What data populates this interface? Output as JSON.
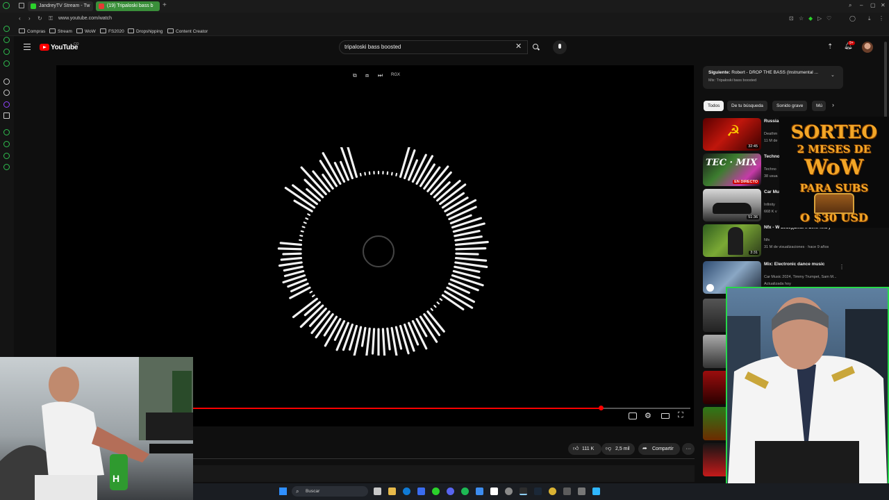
{
  "browser": {
    "tabs": [
      {
        "label": "JandreyTV Stream - Tw"
      },
      {
        "label": "(19) Tripaloski bass b"
      }
    ],
    "new_tab": "+",
    "url": "www.youtube.com/watch",
    "bookmarks": [
      "Compras",
      "Stream",
      "WoW",
      "FS2020",
      "Dropshipping",
      "Content Creator"
    ]
  },
  "youtube": {
    "logo_text": "YouTube",
    "country_code": "CO",
    "search_value": "tripaloski bass boosted",
    "notification_badge": "9+"
  },
  "player": {
    "progress_fraction": 0.82,
    "top_controls": [
      "⧉",
      "⧈",
      "⏭",
      "RGX"
    ]
  },
  "actions": {
    "likes": "111 K",
    "dislikes": "2,5 mil",
    "share": "Compartir",
    "more": "···"
  },
  "up_next": {
    "label_prefix": "Siguiente:",
    "title": "Robert - DROP THE BASS (Instrumental ...",
    "subtitle": "Mix: Tripaloski bass boosted"
  },
  "chips": [
    "Todos",
    "De tu búsqueda",
    "Sonido grave",
    "Mú"
  ],
  "videos": [
    {
      "title": "Russia Bass S",
      "channel": "Deathm",
      "meta": "11 M de",
      "duration": "32:45"
    },
    {
      "title": "Techno majore",
      "channel": "Techno",
      "meta": "38 usua",
      "badge": "EN DIRECTO"
    },
    {
      "title": "Car Mu Booste",
      "channel": "Infinity",
      "meta": "668 K v",
      "duration": "51:36"
    },
    {
      "title": "Nfx - W 2016)(Beat x LeftField )",
      "channel": "Nfx",
      "meta": "31 M de visualizaciones · hace 9 años",
      "duration": "3:31"
    },
    {
      "title": "Mix: Electronic dance music",
      "channel": "Car Music 2024, Timmy Trumpet, Sam M...",
      "meta": "Actualizada hoy"
    }
  ],
  "promo": {
    "line1": "SORTEO",
    "line2": "2 MESES DE",
    "line3": "WoW",
    "line4": "PARA SUBS",
    "line5": "O $30 USD"
  },
  "taskbar": {
    "search_label": "Buscar"
  },
  "colors": {
    "accent_red": "#ff0000",
    "browser_green": "#2bd12b",
    "promo_gold": "#f2a627"
  }
}
